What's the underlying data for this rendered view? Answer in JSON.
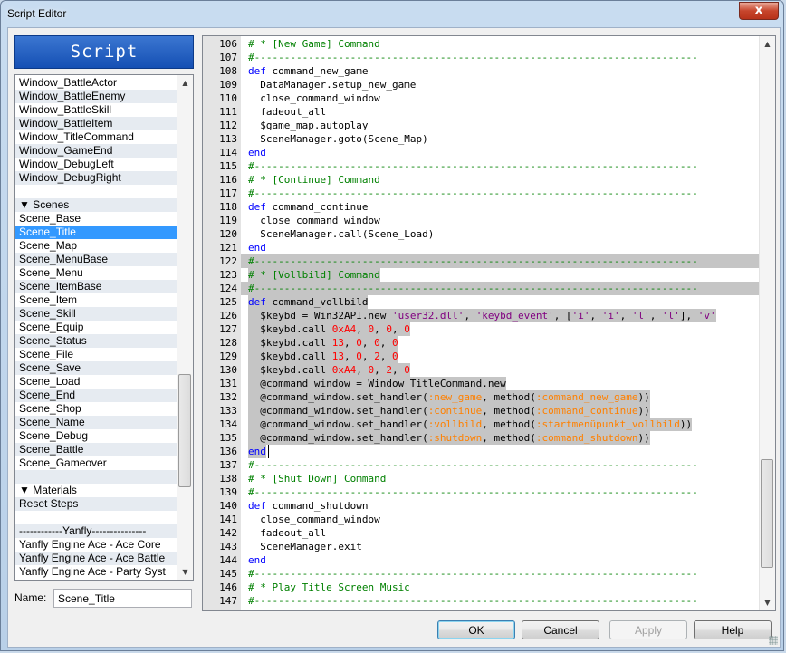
{
  "window": {
    "title": "Script Editor",
    "close_glyph": "x"
  },
  "script_panel": {
    "header": "Script"
  },
  "script_list": [
    {
      "label": "Window_BattleActor",
      "alt": false,
      "selected": false
    },
    {
      "label": "Window_BattleEnemy",
      "alt": true,
      "selected": false
    },
    {
      "label": "Window_BattleSkill",
      "alt": false,
      "selected": false
    },
    {
      "label": "Window_BattleItem",
      "alt": true,
      "selected": false
    },
    {
      "label": "Window_TitleCommand",
      "alt": false,
      "selected": false
    },
    {
      "label": "Window_GameEnd",
      "alt": true,
      "selected": false
    },
    {
      "label": "Window_DebugLeft",
      "alt": false,
      "selected": false
    },
    {
      "label": "Window_DebugRight",
      "alt": true,
      "selected": false
    },
    {
      "label": "",
      "alt": false,
      "selected": false
    },
    {
      "label": "▼ Scenes",
      "alt": true,
      "selected": false
    },
    {
      "label": "Scene_Base",
      "alt": false,
      "selected": false
    },
    {
      "label": "Scene_Title",
      "alt": true,
      "selected": true
    },
    {
      "label": "Scene_Map",
      "alt": false,
      "selected": false
    },
    {
      "label": "Scene_MenuBase",
      "alt": true,
      "selected": false
    },
    {
      "label": "Scene_Menu",
      "alt": false,
      "selected": false
    },
    {
      "label": "Scene_ItemBase",
      "alt": true,
      "selected": false
    },
    {
      "label": "Scene_Item",
      "alt": false,
      "selected": false
    },
    {
      "label": "Scene_Skill",
      "alt": true,
      "selected": false
    },
    {
      "label": "Scene_Equip",
      "alt": false,
      "selected": false
    },
    {
      "label": "Scene_Status",
      "alt": true,
      "selected": false
    },
    {
      "label": "Scene_File",
      "alt": false,
      "selected": false
    },
    {
      "label": "Scene_Save",
      "alt": true,
      "selected": false
    },
    {
      "label": "Scene_Load",
      "alt": false,
      "selected": false
    },
    {
      "label": "Scene_End",
      "alt": true,
      "selected": false
    },
    {
      "label": "Scene_Shop",
      "alt": false,
      "selected": false
    },
    {
      "label": "Scene_Name",
      "alt": true,
      "selected": false
    },
    {
      "label": "Scene_Debug",
      "alt": false,
      "selected": false
    },
    {
      "label": "Scene_Battle",
      "alt": true,
      "selected": false
    },
    {
      "label": "Scene_Gameover",
      "alt": false,
      "selected": false
    },
    {
      "label": "",
      "alt": true,
      "selected": false
    },
    {
      "label": "▼ Materials",
      "alt": false,
      "selected": false
    },
    {
      "label": "Reset Steps",
      "alt": true,
      "selected": false
    },
    {
      "label": "",
      "alt": false,
      "selected": false
    },
    {
      "label": "------------Yanfly---------------",
      "alt": true,
      "selected": false
    },
    {
      "label": "Yanfly Engine Ace - Ace Core",
      "alt": false,
      "selected": false
    },
    {
      "label": "Yanfly Engine Ace - Ace Battle",
      "alt": true,
      "selected": false
    },
    {
      "label": "Yanfly Engine Ace - Party Syst",
      "alt": false,
      "selected": false
    }
  ],
  "name_field": {
    "label": "Name:",
    "value": "Scene_Title"
  },
  "code_lines": [
    {
      "n": "106",
      "hl": false,
      "tokens": [
        [
          "c",
          "# * [New Game] Command"
        ]
      ]
    },
    {
      "n": "107",
      "hl": false,
      "tokens": [
        [
          "c",
          "#--------------------------------------------------------------------------"
        ]
      ]
    },
    {
      "n": "108",
      "hl": false,
      "tokens": [
        [
          "k",
          "def"
        ],
        [
          "i",
          " command_new_game"
        ]
      ]
    },
    {
      "n": "109",
      "hl": false,
      "tokens": [
        [
          "i",
          "  DataManager.setup_new_game"
        ]
      ]
    },
    {
      "n": "110",
      "hl": false,
      "tokens": [
        [
          "i",
          "  close_command_window"
        ]
      ]
    },
    {
      "n": "111",
      "hl": false,
      "tokens": [
        [
          "i",
          "  fadeout_all"
        ]
      ]
    },
    {
      "n": "112",
      "hl": false,
      "tokens": [
        [
          "i",
          "  $game_map.autoplay"
        ]
      ]
    },
    {
      "n": "113",
      "hl": false,
      "tokens": [
        [
          "i",
          "  SceneManager.goto"
        ],
        [
          "o",
          "("
        ],
        [
          "i",
          "Scene_Map"
        ],
        [
          "o",
          ")"
        ]
      ]
    },
    {
      "n": "114",
      "hl": false,
      "tokens": [
        [
          "k",
          "end"
        ]
      ]
    },
    {
      "n": "115",
      "hl": false,
      "tokens": [
        [
          "c",
          "#--------------------------------------------------------------------------"
        ]
      ]
    },
    {
      "n": "116",
      "hl": false,
      "tokens": [
        [
          "c",
          "# * [Continue] Command"
        ]
      ]
    },
    {
      "n": "117",
      "hl": false,
      "tokens": [
        [
          "c",
          "#--------------------------------------------------------------------------"
        ]
      ]
    },
    {
      "n": "118",
      "hl": false,
      "tokens": [
        [
          "k",
          "def"
        ],
        [
          "i",
          " command_continue"
        ]
      ]
    },
    {
      "n": "119",
      "hl": false,
      "tokens": [
        [
          "i",
          "  close_command_window"
        ]
      ]
    },
    {
      "n": "120",
      "hl": false,
      "tokens": [
        [
          "i",
          "  SceneManager.call"
        ],
        [
          "o",
          "("
        ],
        [
          "i",
          "Scene_Load"
        ],
        [
          "o",
          ")"
        ]
      ]
    },
    {
      "n": "121",
      "hl": false,
      "tokens": [
        [
          "k",
          "end"
        ]
      ]
    },
    {
      "n": "122",
      "hl": true,
      "full": true,
      "tokens": [
        [
          "c",
          "#--------------------------------------------------------------------------"
        ]
      ]
    },
    {
      "n": "123",
      "hl": true,
      "tokens": [
        [
          "c",
          "# * [Vollbild] Command"
        ]
      ]
    },
    {
      "n": "124",
      "hl": true,
      "full": true,
      "tokens": [
        [
          "c",
          "#--------------------------------------------------------------------------"
        ]
      ]
    },
    {
      "n": "125",
      "hl": true,
      "tokens": [
        [
          "k",
          "def"
        ],
        [
          "i",
          " command_vollbild"
        ]
      ]
    },
    {
      "n": "126",
      "hl": true,
      "tokens": [
        [
          "i",
          "  $keybd = Win32API.new "
        ],
        [
          "s",
          "'user32.dll'"
        ],
        [
          "o",
          ", "
        ],
        [
          "s",
          "'keybd_event'"
        ],
        [
          "o",
          ", ["
        ],
        [
          "s",
          "'i'"
        ],
        [
          "o",
          ", "
        ],
        [
          "s",
          "'i'"
        ],
        [
          "o",
          ", "
        ],
        [
          "s",
          "'l'"
        ],
        [
          "o",
          ", "
        ],
        [
          "s",
          "'l'"
        ],
        [
          "o",
          "], "
        ],
        [
          "s",
          "'v'"
        ]
      ]
    },
    {
      "n": "127",
      "hl": true,
      "tokens": [
        [
          "i",
          "  $keybd.call "
        ],
        [
          "n",
          "0xA4"
        ],
        [
          "o",
          ", "
        ],
        [
          "n",
          "0"
        ],
        [
          "o",
          ", "
        ],
        [
          "n",
          "0"
        ],
        [
          "o",
          ", "
        ],
        [
          "n",
          "0"
        ]
      ]
    },
    {
      "n": "128",
      "hl": true,
      "tokens": [
        [
          "i",
          "  $keybd.call "
        ],
        [
          "n",
          "13"
        ],
        [
          "o",
          ", "
        ],
        [
          "n",
          "0"
        ],
        [
          "o",
          ", "
        ],
        [
          "n",
          "0"
        ],
        [
          "o",
          ", "
        ],
        [
          "n",
          "0"
        ]
      ]
    },
    {
      "n": "129",
      "hl": true,
      "tokens": [
        [
          "i",
          "  $keybd.call "
        ],
        [
          "n",
          "13"
        ],
        [
          "o",
          ", "
        ],
        [
          "n",
          "0"
        ],
        [
          "o",
          ", "
        ],
        [
          "n",
          "2"
        ],
        [
          "o",
          ", "
        ],
        [
          "n",
          "0"
        ]
      ]
    },
    {
      "n": "130",
      "hl": true,
      "tokens": [
        [
          "i",
          "  $keybd.call "
        ],
        [
          "n",
          "0xA4"
        ],
        [
          "o",
          ", "
        ],
        [
          "n",
          "0"
        ],
        [
          "o",
          ", "
        ],
        [
          "n",
          "2"
        ],
        [
          "o",
          ", "
        ],
        [
          "n",
          "0"
        ]
      ]
    },
    {
      "n": "131",
      "hl": true,
      "tokens": [
        [
          "i",
          "  @command_window = Window_TitleCommand.new"
        ]
      ]
    },
    {
      "n": "132",
      "hl": true,
      "tokens": [
        [
          "i",
          "  @command_window.set_handler"
        ],
        [
          "o",
          "("
        ],
        [
          "y",
          ":new_game"
        ],
        [
          "o",
          ", method("
        ],
        [
          "y",
          ":command_new_game"
        ],
        [
          "o",
          "))"
        ]
      ]
    },
    {
      "n": "133",
      "hl": true,
      "tokens": [
        [
          "i",
          "  @command_window.set_handler"
        ],
        [
          "o",
          "("
        ],
        [
          "y",
          ":continue"
        ],
        [
          "o",
          ", method("
        ],
        [
          "y",
          ":command_continue"
        ],
        [
          "o",
          "))"
        ]
      ]
    },
    {
      "n": "134",
      "hl": true,
      "tokens": [
        [
          "i",
          "  @command_window.set_handler"
        ],
        [
          "o",
          "("
        ],
        [
          "y",
          ":vollbild"
        ],
        [
          "o",
          ", method("
        ],
        [
          "y",
          ":startmenüpunkt_vollbild"
        ],
        [
          "o",
          "))"
        ]
      ]
    },
    {
      "n": "135",
      "hl": true,
      "tokens": [
        [
          "i",
          "  @command_window.set_handler"
        ],
        [
          "o",
          "("
        ],
        [
          "y",
          ":shutdown"
        ],
        [
          "o",
          ", method("
        ],
        [
          "y",
          ":command_shutdown"
        ],
        [
          "o",
          "))"
        ]
      ]
    },
    {
      "n": "136",
      "hl": true,
      "caret": true,
      "tokens": [
        [
          "k",
          "end"
        ]
      ]
    },
    {
      "n": "137",
      "hl": false,
      "tokens": [
        [
          "c",
          "#--------------------------------------------------------------------------"
        ]
      ]
    },
    {
      "n": "138",
      "hl": false,
      "tokens": [
        [
          "c",
          "# * [Shut Down] Command"
        ]
      ]
    },
    {
      "n": "139",
      "hl": false,
      "tokens": [
        [
          "c",
          "#--------------------------------------------------------------------------"
        ]
      ]
    },
    {
      "n": "140",
      "hl": false,
      "tokens": [
        [
          "k",
          "def"
        ],
        [
          "i",
          " command_shutdown"
        ]
      ]
    },
    {
      "n": "141",
      "hl": false,
      "tokens": [
        [
          "i",
          "  close_command_window"
        ]
      ]
    },
    {
      "n": "142",
      "hl": false,
      "tokens": [
        [
          "i",
          "  fadeout_all"
        ]
      ]
    },
    {
      "n": "143",
      "hl": false,
      "tokens": [
        [
          "i",
          "  SceneManager.exit"
        ]
      ]
    },
    {
      "n": "144",
      "hl": false,
      "tokens": [
        [
          "k",
          "end"
        ]
      ]
    },
    {
      "n": "145",
      "hl": false,
      "tokens": [
        [
          "c",
          "#--------------------------------------------------------------------------"
        ]
      ]
    },
    {
      "n": "146",
      "hl": false,
      "tokens": [
        [
          "c",
          "# * Play Title Screen Music"
        ]
      ]
    },
    {
      "n": "147",
      "hl": false,
      "tokens": [
        [
          "c",
          "#--------------------------------------------------------------------------"
        ]
      ]
    }
  ],
  "buttons": {
    "ok": "OK",
    "cancel": "Cancel",
    "apply": "Apply",
    "help": "Help"
  },
  "colors": {
    "comment": "#008000",
    "keyword": "#0000ff",
    "string": "#800080",
    "number": "#ff0000",
    "symbol": "#ff8000",
    "selection": "#c5c5c5",
    "list_selected": "#3399ff",
    "header": "#1f5bbf"
  }
}
